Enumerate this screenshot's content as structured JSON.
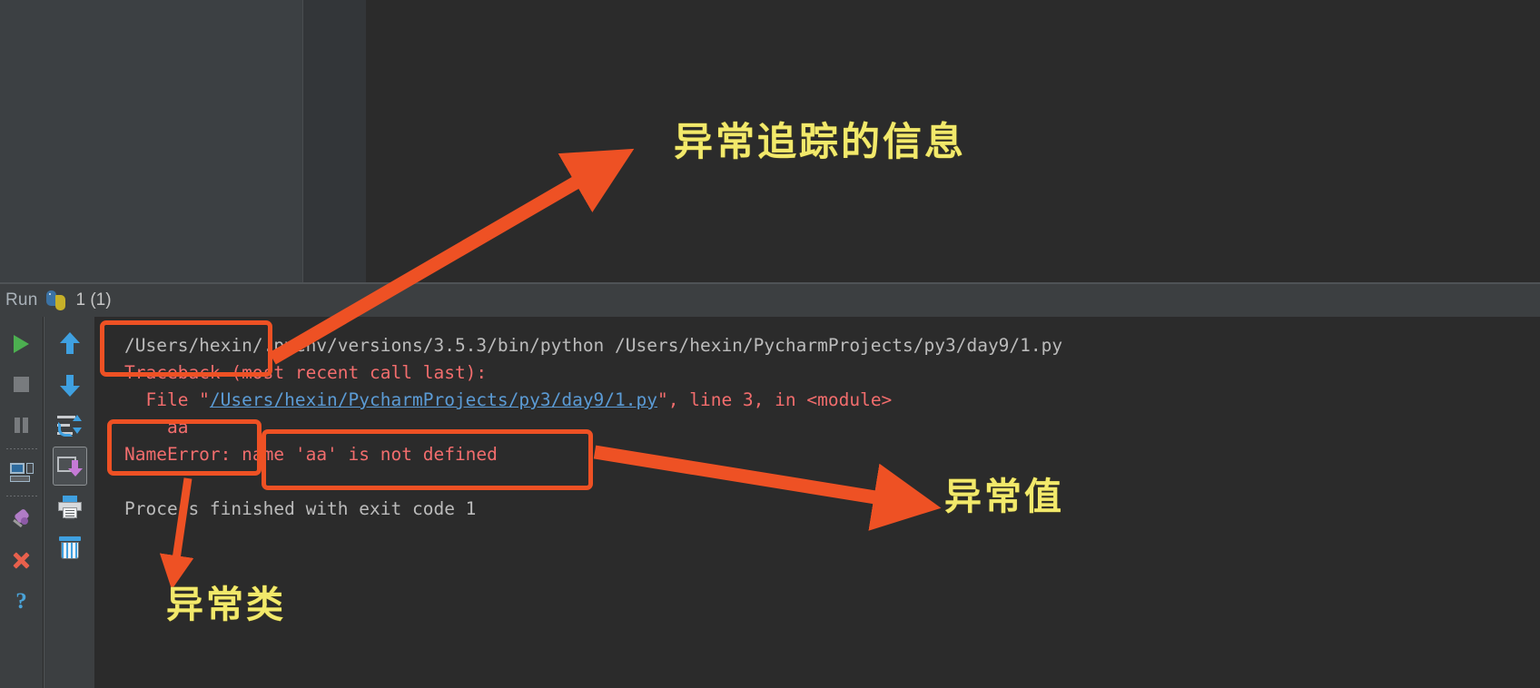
{
  "window": {
    "background_color": "#2b2b2b",
    "editor_panel_color": "#3c4043"
  },
  "run_tool_window": {
    "title": "Run",
    "icon": "python-icon",
    "configuration_name": "1 (1)"
  },
  "left_toolbar": {
    "buttons": [
      {
        "name": "rerun-button",
        "icon": "play-icon",
        "tooltip": "Rerun"
      },
      {
        "name": "stop-button",
        "icon": "stop-icon",
        "tooltip": "Stop"
      },
      {
        "name": "pause-button",
        "icon": "pause-icon",
        "tooltip": "Pause Output"
      },
      {
        "name": "show-console-button",
        "icon": "console-icon",
        "tooltip": "Show Console"
      },
      {
        "name": "pin-tab-button",
        "icon": "pin-icon",
        "tooltip": "Pin Tab"
      },
      {
        "name": "close-button",
        "icon": "close-x-icon",
        "tooltip": "Close"
      },
      {
        "name": "help-button",
        "icon": "question-mark-icon",
        "tooltip": "Help"
      }
    ]
  },
  "console_toolbar": {
    "buttons": [
      {
        "name": "up-the-stack-trace-button",
        "icon": "arrow-up-icon",
        "tooltip": "Up the Stack Trace"
      },
      {
        "name": "down-the-stack-trace-button",
        "icon": "arrow-down-icon",
        "tooltip": "Down the Stack Trace"
      },
      {
        "name": "soft-wrap-button",
        "icon": "soft-wrap-icon",
        "tooltip": "Use Soft Wraps"
      },
      {
        "name": "scroll-to-end-button",
        "icon": "scroll-to-end-icon",
        "tooltip": "Scroll to the End",
        "selected": true
      },
      {
        "name": "print-button",
        "icon": "printer-icon",
        "tooltip": "Print"
      },
      {
        "name": "clear-all-button",
        "icon": "trash-icon",
        "tooltip": "Clear All"
      }
    ]
  },
  "console_output": {
    "lines": [
      {
        "id": "command-line",
        "segments": [
          {
            "text": "/Users/hexin/.pyenv/versions/3.5.3/bin/python /Users/hexin/PycharmProjects/py3/day9/1.py",
            "style": "white"
          }
        ]
      },
      {
        "id": "traceback-header",
        "segments": [
          {
            "text": "Traceback (most recent call last):",
            "style": "error"
          }
        ]
      },
      {
        "id": "file-line",
        "segments": [
          {
            "text": "  File \"",
            "style": "error"
          },
          {
            "text": "/Users/hexin/PycharmProjects/py3/day9/1.py",
            "style": "link"
          },
          {
            "text": "\", line 3, in <module>",
            "style": "error"
          }
        ]
      },
      {
        "id": "source-line",
        "segments": [
          {
            "text": "    aa",
            "style": "error"
          }
        ]
      },
      {
        "id": "exception-line",
        "segments": [
          {
            "text": "NameError: name 'aa' is not defined",
            "style": "error"
          }
        ]
      },
      {
        "id": "blank-line",
        "segments": [
          {
            "text": "",
            "style": "white"
          }
        ]
      },
      {
        "id": "process-finished-line",
        "segments": [
          {
            "text": "Process finished with exit code 1",
            "style": "white"
          }
        ]
      }
    ]
  },
  "annotations": {
    "accent_color": "#ee5124",
    "label_color": "#f2e96b",
    "labels": [
      {
        "id": "traceback",
        "text": "异常追踪的信息"
      },
      {
        "id": "value",
        "text": "异常值"
      },
      {
        "id": "class",
        "text": "异常类"
      }
    ],
    "boxes": [
      {
        "id": "traceback-box",
        "target": "Traceback"
      },
      {
        "id": "nameerror-box",
        "target": "NameError"
      },
      {
        "id": "value-box",
        "target": "name 'aa' is not defined"
      }
    ],
    "arrows": [
      {
        "id": "traceback-arrow",
        "from": "traceback-box",
        "to": "traceback-label"
      },
      {
        "id": "value-arrow",
        "from": "value-box",
        "to": "value-label"
      },
      {
        "id": "class-arrow",
        "from": "nameerror-box",
        "to": "class-label"
      }
    ]
  }
}
